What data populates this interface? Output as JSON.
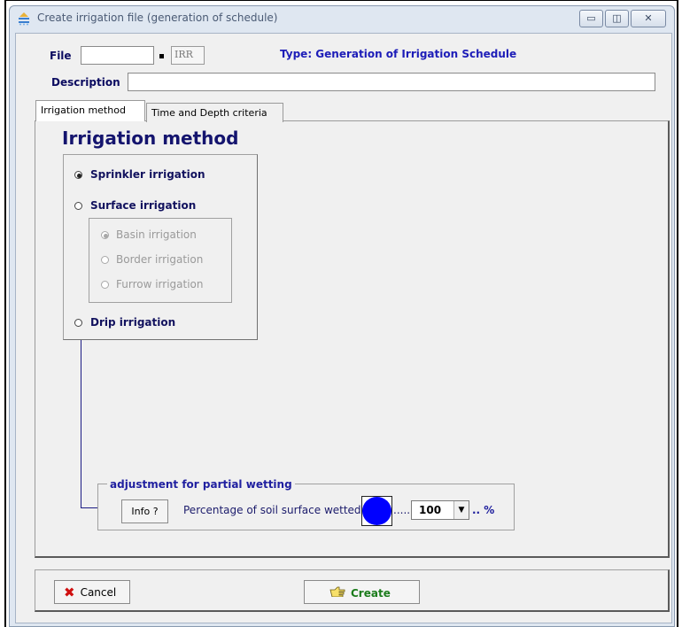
{
  "window": {
    "title": "Create irrigation file (generation of schedule)",
    "controls": {
      "minimize": "▭",
      "maximize": "◫",
      "close": "✕"
    }
  },
  "file": {
    "label": "File",
    "name_value": "",
    "extension": "IRR",
    "type_label": "Type: Generation of Irrigation Schedule"
  },
  "description": {
    "label": "Description",
    "value": ""
  },
  "tabs": [
    {
      "label": "Irrigation method",
      "active": true
    },
    {
      "label": "Time and Depth criteria",
      "active": false
    }
  ],
  "method_panel": {
    "heading": "Irrigation method",
    "options": [
      {
        "label": "Sprinkler irrigation",
        "checked": true
      },
      {
        "label": "Surface irrigation",
        "checked": false
      },
      {
        "label": "Drip irrigation",
        "checked": false
      }
    ],
    "surface_options": [
      {
        "label": "Basin irrigation",
        "checked": true,
        "enabled": false
      },
      {
        "label": "Border irrigation",
        "checked": false,
        "enabled": false
      },
      {
        "label": "Furrow irrigation",
        "checked": false,
        "enabled": false
      }
    ]
  },
  "partial_wetting": {
    "title": "adjustment for partial wetting",
    "info_button": "Info ?",
    "text": "Percentage of soil surface wetted.",
    "dots_after": ".....",
    "value": "100",
    "unit": ".. %"
  },
  "buttons": {
    "cancel": "Cancel",
    "create": "Create"
  },
  "icons": {
    "app": "irrigation-app-icon",
    "cancel": "red-x-icon",
    "create": "pointing-hand-icon",
    "dropdown": "dropdown-arrow-icon"
  },
  "colors": {
    "accent_blue": "#0000ff",
    "heading_navy": "#14146e",
    "create_green": "#1c7c1c",
    "cancel_red": "#d01010"
  }
}
